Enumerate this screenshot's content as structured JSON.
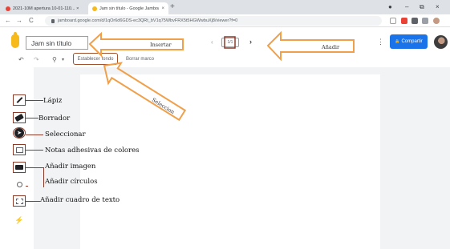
{
  "browser": {
    "tabs": [
      {
        "title": "2021-10M apertura 10-01-110... ×",
        "active": false
      },
      {
        "title": "Jam sin título - Google Jamboard",
        "active": true
      }
    ],
    "tab_close": "×",
    "new_tab": "+",
    "url": "jamboard.google.com/d/1qOr6d6GDS-ec3QRt_bV1q75WbvFRX5t5HGWwbuXj8/viewer?f=0",
    "nav": {
      "back": "←",
      "forward": "→",
      "reload": "C"
    },
    "window_controls": {
      "minimize": "–",
      "maximize": "⧉",
      "close": "×",
      "account": "●"
    }
  },
  "header": {
    "title": "Jam sin título",
    "frame_prev": "‹",
    "frame_indicator": "1/1",
    "frame_next": "›",
    "more": "⋮",
    "share_label": "Compartir",
    "share_icon": "🔒"
  },
  "toolbar": {
    "undo": "↶",
    "redo": "↷",
    "zoom": "⚲",
    "zoom_menu": "▾",
    "set_background": "Establecer fondo",
    "clear_frame": "Borrar marco"
  },
  "tools": [
    {
      "name": "pen",
      "icon": "pen-icon",
      "label": "Lápiz"
    },
    {
      "name": "eraser",
      "icon": "eraser-icon",
      "label": "Borrador"
    },
    {
      "name": "select",
      "icon": "cursor-icon",
      "label": "Seleccionar"
    },
    {
      "name": "sticky-note",
      "icon": "sticky-note-icon",
      "label": "Notas adhesivas de colores"
    },
    {
      "name": "image",
      "icon": "image-icon",
      "label": "Añadir imagen"
    },
    {
      "name": "circle",
      "icon": "circle-icon",
      "label": "Añadir círculos"
    },
    {
      "name": "text-box",
      "icon": "text-box-icon",
      "label": "Añadir cuadro de texto"
    },
    {
      "name": "laser",
      "icon": "laser-icon",
      "label": ""
    }
  ],
  "annotations": {
    "insert": "Insertar",
    "add": "Añadir",
    "select": "Seleccion"
  },
  "colors": {
    "share_blue": "#1a73e8",
    "annotation_orange": "#f0a04b",
    "annotation_red": "#8b3a2a",
    "canvas_bg": "#f1f3f4"
  }
}
